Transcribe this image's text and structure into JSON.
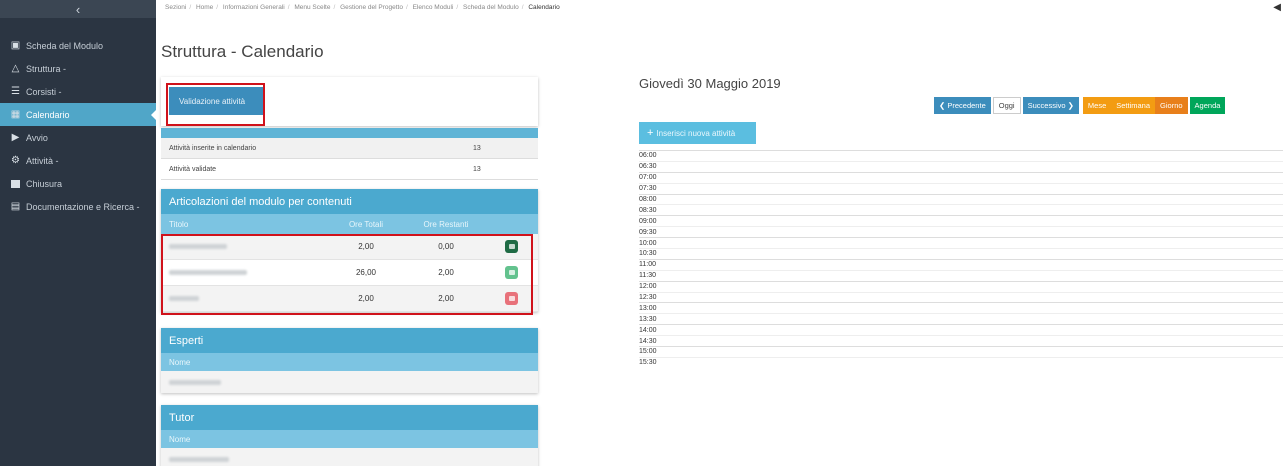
{
  "sidebar": {
    "toggle_icon": "chevron-left-icon",
    "items": [
      {
        "label": "Scheda del Modulo",
        "icon": "document-icon"
      },
      {
        "label": "Struttura -",
        "icon": "sitemap-icon"
      },
      {
        "label": "Corsisti -",
        "icon": "users-icon"
      },
      {
        "label": "Calendario",
        "icon": "calendar-icon"
      },
      {
        "label": "Avvio",
        "icon": "play-icon"
      },
      {
        "label": "Attività -",
        "icon": "cogs-icon"
      },
      {
        "label": "Chiusura",
        "icon": "stop-icon"
      },
      {
        "label": "Documentazione e Ricerca -",
        "icon": "book-icon"
      }
    ]
  },
  "breadcrumb": [
    "Sezioni",
    "Home",
    "Informazioni Generali",
    "Menu Scelte",
    "Gestione del Progetto",
    "Elenco Moduli",
    "Scheda del Modulo",
    "Calendario"
  ],
  "page_title": "Struttura - Calendario",
  "validate_button": "Validazione attività",
  "stats": [
    {
      "label": "Attività inserite in calendario",
      "value": "13"
    },
    {
      "label": "Attività validate",
      "value": "13"
    }
  ],
  "articolazioni": {
    "title": "Articolazioni del modulo per contenuti",
    "headers": {
      "titolo": "Titolo",
      "ore_totali": "Ore Totali",
      "ore_restanti": "Ore Restanti"
    },
    "rows": [
      {
        "ore_totali": "2,00",
        "ore_restanti": "0,00",
        "color": "#1f6b45"
      },
      {
        "ore_totali": "26,00",
        "ore_restanti": "2,00",
        "color": "#63c28e"
      },
      {
        "ore_totali": "2,00",
        "ore_restanti": "2,00",
        "color": "#e8717a"
      }
    ]
  },
  "esperti": {
    "title": "Esperti",
    "header": "Nome"
  },
  "tutor": {
    "title": "Tutor",
    "header": "Nome"
  },
  "calendar": {
    "date": "Giovedì 30 Maggio 2019",
    "nav": {
      "prev": "Precedente",
      "today": "Oggi",
      "next": "Successivo",
      "month": "Mese",
      "week": "Settimana",
      "day": "Giorno",
      "agenda": "Agenda"
    },
    "add_button": "Inserisci nuova attività",
    "times": [
      "06:00",
      "06:30",
      "07:00",
      "07:30",
      "08:00",
      "08:30",
      "09:00",
      "09:30",
      "10:00",
      "10:30",
      "11:00",
      "11:30",
      "12:00",
      "12:30",
      "13:00",
      "13:30",
      "14:00",
      "14:30",
      "15:00",
      "15:30"
    ]
  }
}
